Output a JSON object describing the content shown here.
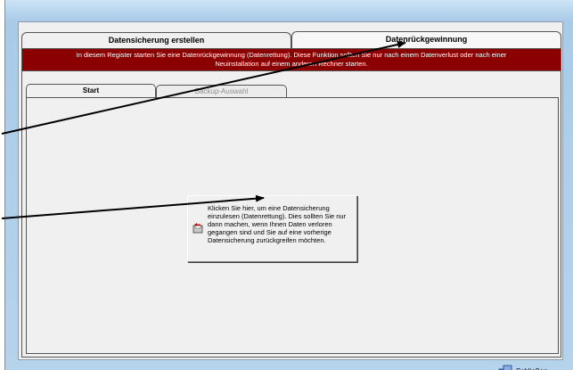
{
  "tabs": {
    "backup_create": "Datensicherung erstellen",
    "data_recovery": "Datenrückgewinnung"
  },
  "banner": {
    "line1": "In diesem Register starten Sie eine Datenrückgewinnung (Datenrettung). Diese Funktion sollten Sie nur nach einem Datenverlust oder nach einer",
    "line2": "Neuinstallation auf einem anderen Rechner starten."
  },
  "subtabs": {
    "start": "Start",
    "backup_selection": "Backup-Auswahl"
  },
  "restore_button": {
    "text": "Klicken Sie hier, um eine Datensicherung einzulesen (Datenrettung). Dies sollten Sie nur dann machen, wenn Ihnen Daten verloren gegangen sind und Sie auf eine vorherige Datensicherung zurückgreifen möchten."
  },
  "footer": {
    "close_label": "Schließen"
  },
  "colors": {
    "banner_bg": "#8b0000",
    "banner_text": "#ffffff",
    "panel_bg": "#f0f0f0",
    "annotation_arrow": "#000000"
  },
  "icons": {
    "restore": "disk-restore-icon",
    "close": "exit-door-icon"
  }
}
